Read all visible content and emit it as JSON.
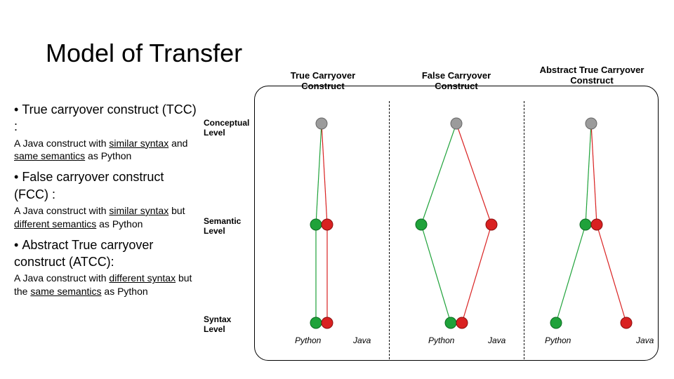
{
  "title": "Model of Transfer",
  "bullets": {
    "tcc": {
      "label": "True carryover construct (TCC) :",
      "desc_pre": "A Java construct with ",
      "desc_u1": "similar syntax",
      "desc_mid": " and ",
      "desc_u2": "same semantics",
      "desc_post": " as Python"
    },
    "fcc": {
      "label": "False carryover construct (FCC) :",
      "desc_pre": "A Java construct with ",
      "desc_u1": "similar syntax",
      "desc_mid": " but ",
      "desc_u2": "different semantics",
      "desc_post": " as Python"
    },
    "atcc": {
      "label": "Abstract True carryover construct (ATCC):",
      "desc_pre": "A Java construct with ",
      "desc_u1": "different syntax",
      "desc_mid": " but the ",
      "desc_u2": "same semantics",
      "desc_post": " as Python"
    }
  },
  "diagram": {
    "headers": {
      "tcc": "True Carryover Construct",
      "fcc": "False Carryover Construct",
      "atcc": "Abstract True Carryover Construct"
    },
    "rows": {
      "conceptual": "Conceptual Level",
      "semantic": "Semantic Level",
      "syntax": "Syntax Level"
    },
    "lang": {
      "python": "Python",
      "java": "Java"
    }
  },
  "chart_data": {
    "type": "diagram",
    "levels": [
      "Conceptual",
      "Semantic",
      "Syntax"
    ],
    "languages": [
      "Python",
      "Java"
    ],
    "columns": [
      {
        "name": "True Carryover Construct",
        "conceptual": "shared",
        "semantic": {
          "Python": "green",
          "Java": "red",
          "separation": "close"
        },
        "syntax": {
          "Python": "green",
          "Java": "red",
          "separation": "close"
        }
      },
      {
        "name": "False Carryover Construct",
        "conceptual": "shared",
        "semantic": {
          "Python": "green",
          "Java": "red",
          "separation": "wide"
        },
        "syntax": {
          "Python": "green",
          "Java": "red",
          "separation": "close"
        }
      },
      {
        "name": "Abstract True Carryover Construct",
        "conceptual": "shared",
        "semantic": {
          "Python": "green",
          "Java": "red",
          "separation": "close"
        },
        "syntax": {
          "Python": "green",
          "Java": "red",
          "separation": "wide"
        }
      }
    ]
  }
}
